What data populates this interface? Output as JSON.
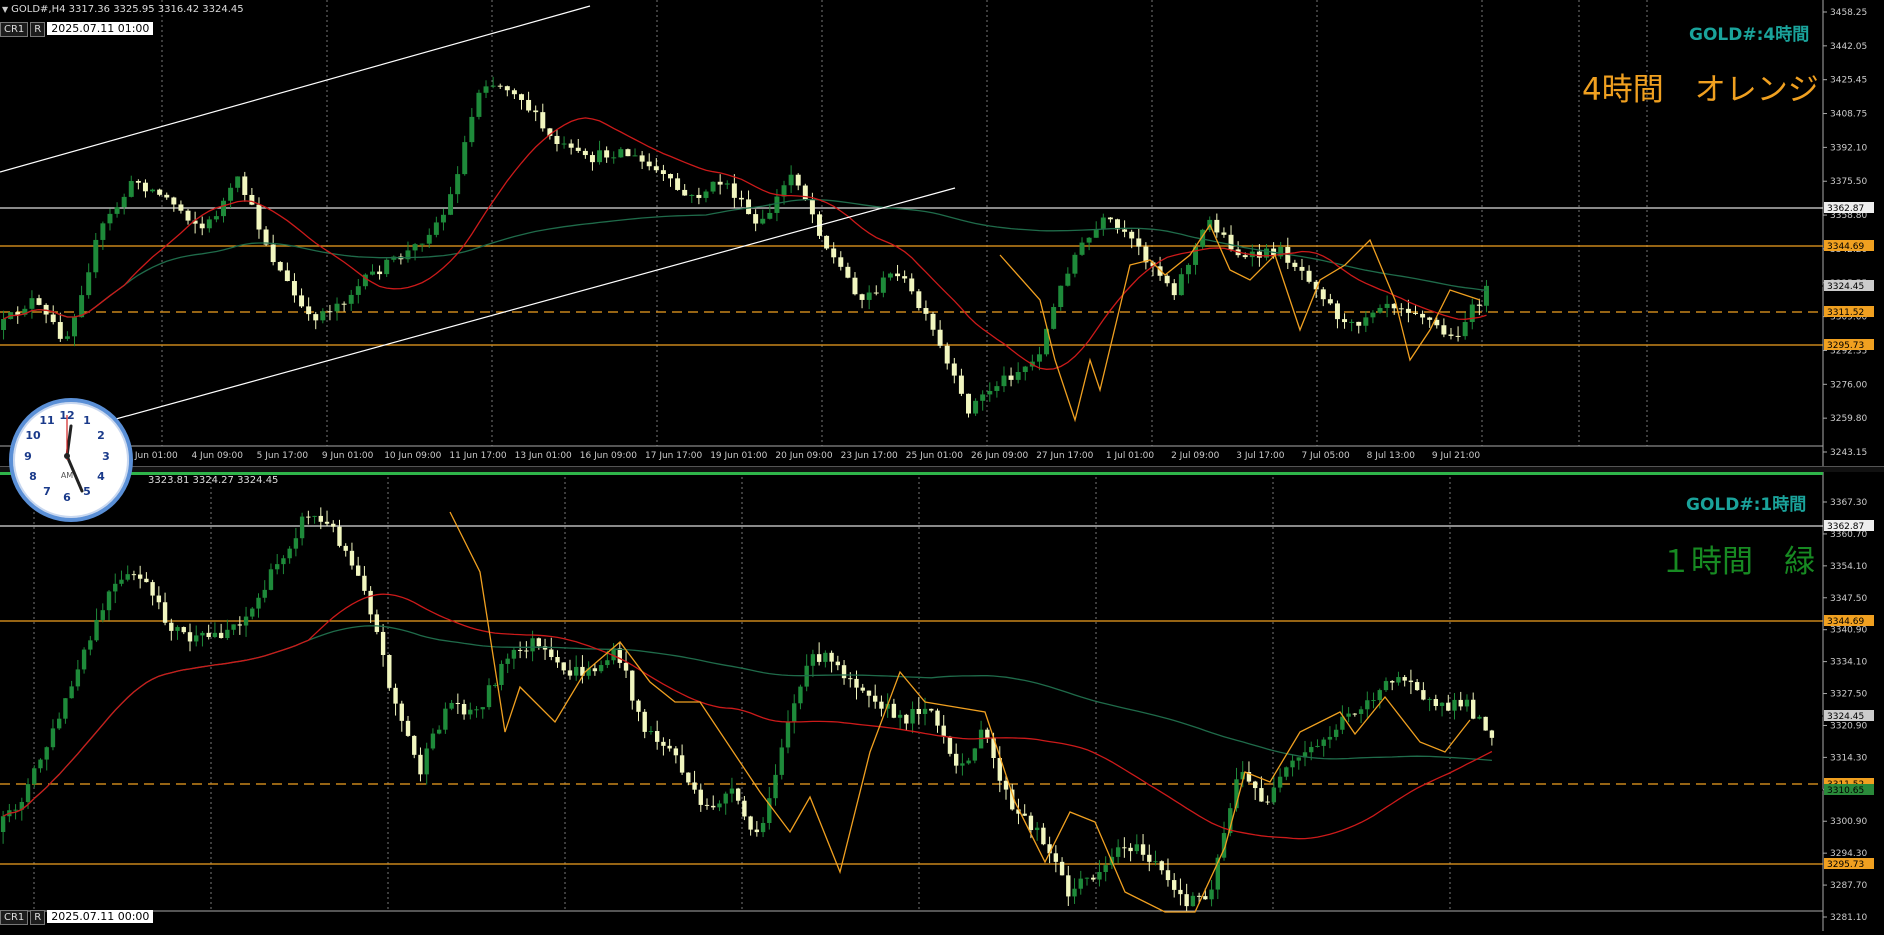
{
  "top": {
    "header": "GOLD#,H4  3317.36 3325.95 3316.42 3324.45",
    "cr_label": "CR1",
    "r_label": "R",
    "date": "2025.07.11 01:00",
    "title": "GOLD#:4時間",
    "big_label": "4時間　オレンジ",
    "prices": [
      "3458.25",
      "3442.05",
      "3425.45",
      "3408.75",
      "3392.10",
      "3375.50",
      "3358.80",
      "3342.20",
      "3325.55",
      "3309.00",
      "3292.35",
      "3276.00",
      "3259.80",
      "3243.15"
    ],
    "level_labels": [
      "3362.87",
      "3344.69",
      "3324.45",
      "3311.52",
      "3295.73"
    ],
    "xlabels": [
      "3 Jun 01:00",
      "4 Jun 09:00",
      "5 Jun 17:00",
      "9 Jun 01:00",
      "10 Jun 09:00",
      "11 Jun 17:00",
      "13 Jun 01:00",
      "16 Jun 09:00",
      "17 Jun 17:00",
      "19 Jun 01:00",
      "20 Jun 09:00",
      "23 Jun 17:00",
      "25 Jun 01:00",
      "26 Jun 09:00",
      "27 Jun 17:00",
      "1 Jul 01:00",
      "2 Jul 09:00",
      "3 Jul 17:00",
      "7 Jul 05:00",
      "8 Jul 13:00",
      "9 Jul 21:00"
    ]
  },
  "bottom": {
    "header": "3323.81 3324.27 3324.45",
    "cr_label": "CR1",
    "r_label": "R",
    "date": "2025.07.11 00:00",
    "title": "GOLD#:1時間",
    "big_label": "１時間　緑",
    "prices": [
      "3367.30",
      "3360.70",
      "3354.10",
      "3347.50",
      "3340.90",
      "3334.10",
      "3327.50",
      "3320.90",
      "3314.30",
      "3307.60",
      "3300.90",
      "3294.30",
      "3287.70",
      "3281.10"
    ],
    "level_labels": [
      "3362.87",
      "3344.69",
      "3324.45",
      "3311.52",
      "3310.65",
      "3295.73"
    ]
  },
  "clock": {
    "am": "AM"
  },
  "colors": {
    "bull": "#1e8a3a",
    "bear": "#f2f7c0",
    "ma_red": "#cc1a1a",
    "ma_green": "#1f6b4a",
    "orange": "#f0a020",
    "zigzag": "#f0a020",
    "title_cyan": "#1aa39b",
    "label_orange": "#f0a020",
    "label_green": "#178a22"
  }
}
